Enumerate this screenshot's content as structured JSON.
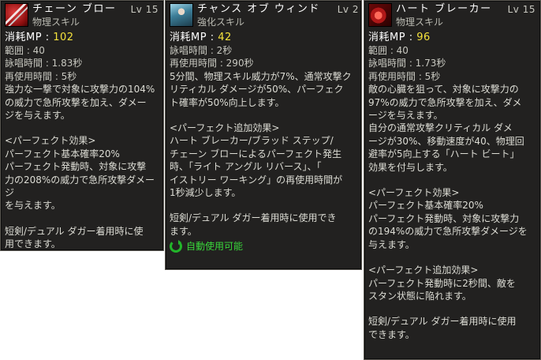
{
  "tooltips": [
    {
      "name": "チェーン ブロー",
      "level": "Lv 15",
      "type": "物理スキル",
      "icon": "chain-blow-skill-icon",
      "mp_label": "消耗MP",
      "mp_value": "102",
      "stats": [
        "範囲 : 40",
        "詠唱時間 : 1.83秒",
        "再使用時間 : 5秒"
      ],
      "desc1": "強力な一撃で対象に攻撃力の104%\nの威力で急所攻撃を加え、ダメー\nジを与えます。",
      "perfect_header": "<パーフェクト効果>",
      "perfect_text": "パーフェクト基本確率20%\nパーフェクト発動時、対象に攻撃\n力の208%の威力で急所攻撃ダメージ\nを与えます。",
      "weapon_req": "短剣/デュアル ダガー着用時に使\n用できます。"
    },
    {
      "name": "チャンス オブ ウィンド",
      "level": "Lv 2",
      "type": "強化スキル",
      "icon": "chance-of-wind-skill-icon",
      "mp_label": "消耗MP",
      "mp_value": "42",
      "stats": [
        "詠唱時間 : 2秒",
        "再使用時間 : 290秒"
      ],
      "desc1": "5分間、物理スキル威力が7%、通常攻撃ク\nリティカル ダメージが50%、パーフェク\nト確率が50%向上します。",
      "perfect_header": "<パーフェクト追加効果>",
      "perfect_text": "ハート ブレーカー/ブラッド ステップ/\nチェーン ブローによるパーフェクト発生\n時、「ライト アングル リバース」、「\nイストリー ワーキング」の再使用時間が\n1秒減少します。",
      "weapon_req": "短剣/デュアル ダガー着用時に使用でき\nます。",
      "auto_use": "自動使用可能"
    },
    {
      "name": "ハート ブレーカー",
      "level": "Lv 15",
      "type": "物理スキル",
      "icon": "heart-breaker-skill-icon",
      "mp_label": "消耗MP",
      "mp_value": "96",
      "stats": [
        "範囲 : 40",
        "詠唱時間 : 1.73秒",
        "再使用時間 : 5秒"
      ],
      "desc1": "敵の心臓を狙って、対象に攻撃力の\n97%の威力で急所攻撃を加え、ダメ\nージを与えます。\n自分の通常攻撃クリティカル ダメ\nージが30%、移動速度が40、物理回\n避率が5向上する「ハート ビート」\n効果を付与します。",
      "perfect_header": "<パーフェクト効果>",
      "perfect_text": "パーフェクト基本確率20%\nパーフェクト発動時、対象に攻撃力\nの194%の威力で急所攻撃ダメージを\n与えます。",
      "perfect_header2": "<パーフェクト追加効果>",
      "perfect_text2": "パーフェクト発動時に2秒間、敵を\nスタン状態に陥れます。",
      "weapon_req": "短剣/デュアル ダガー着用時に使用\nできます。"
    }
  ],
  "colors": {
    "panel_bg": "#222120",
    "mp_value": "#f5e23c",
    "auto_use": "#39d63a"
  }
}
